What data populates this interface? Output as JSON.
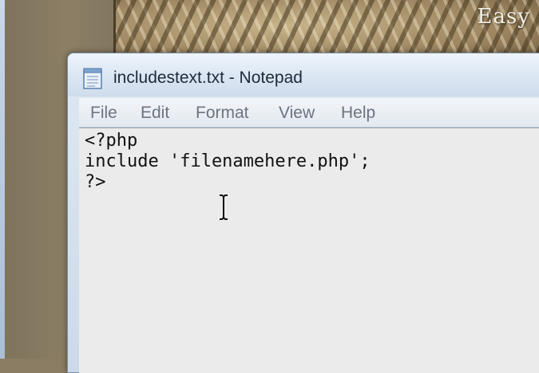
{
  "background": {
    "banner_text": "Easy"
  },
  "window": {
    "title": "includestext.txt - Notepad",
    "icon": "notepad-icon"
  },
  "menu": {
    "items": [
      {
        "label": "File"
      },
      {
        "label": "Edit"
      },
      {
        "label": "Format"
      },
      {
        "label": "View"
      },
      {
        "label": "Help"
      }
    ]
  },
  "editor": {
    "content": "<?php\ninclude 'filenamehere.php';\n?>",
    "cursor": "i-beam-cursor-icon"
  }
}
